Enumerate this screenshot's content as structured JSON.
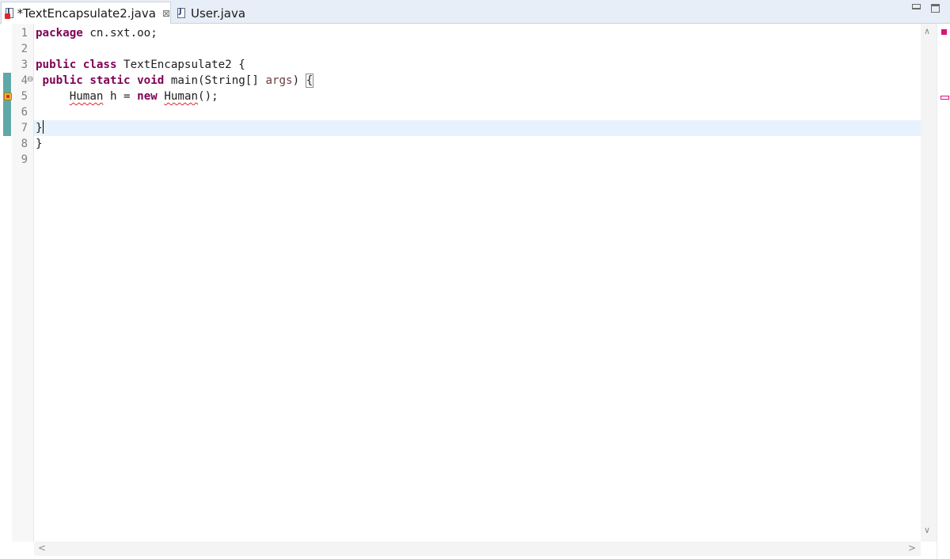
{
  "tabs": [
    {
      "label": "*TextEncapsulate2.java",
      "active": true,
      "has_error": true,
      "close_glyph": "⊠"
    },
    {
      "label": "User.java",
      "active": false,
      "has_error": false
    }
  ],
  "editor": {
    "line_numbers": [
      "1",
      "2",
      "3",
      "4",
      "5",
      "6",
      "7",
      "8",
      "9"
    ],
    "lines": [
      [
        {
          "t": "package",
          "c": "kw"
        },
        {
          "t": " cn.sxt.oo;"
        }
      ],
      [],
      [
        {
          "t": "public",
          "c": "kw"
        },
        {
          "t": " "
        },
        {
          "t": "class",
          "c": "kw"
        },
        {
          "t": " TextEncapsulate2 {"
        }
      ],
      [
        {
          "t": " "
        },
        {
          "t": "public",
          "c": "kw"
        },
        {
          "t": " "
        },
        {
          "t": "static",
          "c": "kw"
        },
        {
          "t": " "
        },
        {
          "t": "void",
          "c": "kw"
        },
        {
          "t": " main(String[] "
        },
        {
          "t": "args",
          "c": "param"
        },
        {
          "t": ") "
        },
        {
          "t": "{",
          "c": "bracket-box"
        }
      ],
      [
        {
          "t": "     "
        },
        {
          "t": "Human",
          "c": "squig"
        },
        {
          "t": " h = "
        },
        {
          "t": "new",
          "c": "kw"
        },
        {
          "t": " "
        },
        {
          "t": "Human",
          "c": "squig"
        },
        {
          "t": "();"
        }
      ],
      [],
      [
        {
          "t": "}"
        },
        {
          "caret": true
        }
      ],
      [
        {
          "t": "}"
        }
      ],
      []
    ],
    "current_line": 7,
    "fold_line": 4,
    "fold_glyph": "⊖",
    "error_line": 5,
    "changed_lines": [
      4,
      7
    ]
  },
  "colors": {
    "keyword": "#7f0055",
    "parameter": "#6a3e3e",
    "current_line_bg": "#e8f2fe",
    "change_bar": "#5fa8a8",
    "error": "#e0262b"
  }
}
